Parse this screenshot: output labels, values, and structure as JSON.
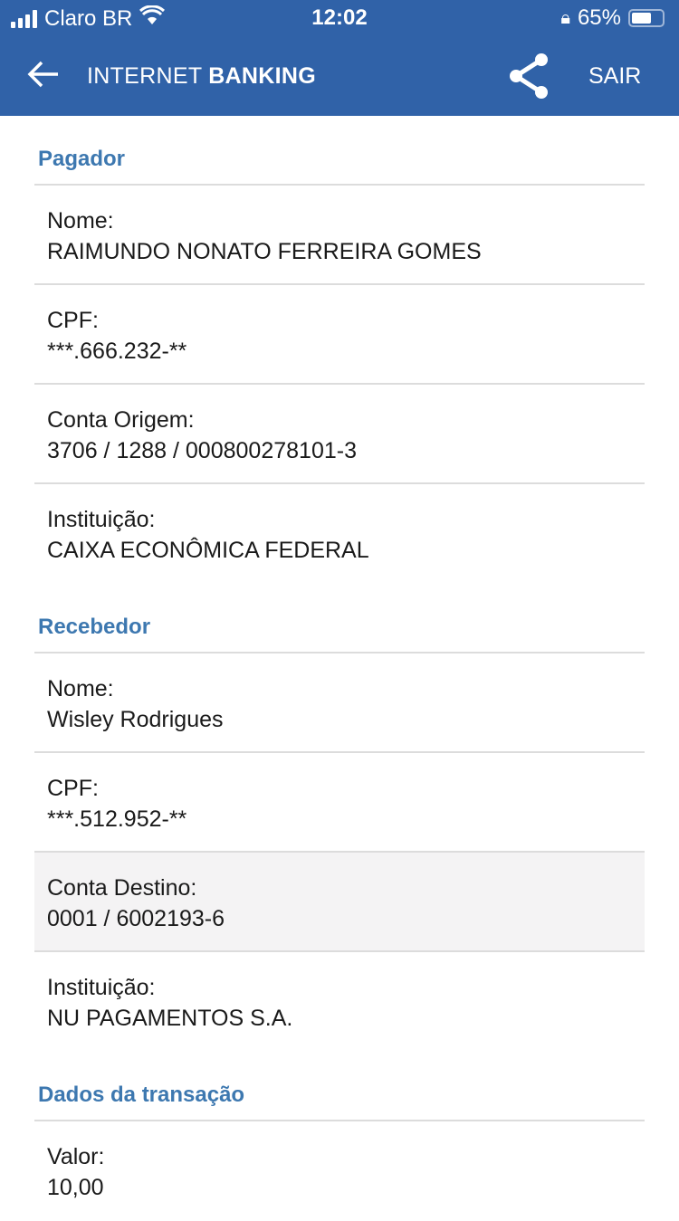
{
  "status": {
    "carrier": "Claro BR",
    "time": "12:02",
    "battery": "65%",
    "battery_level": 0.65
  },
  "header": {
    "title_light": "INTERNET",
    "title_bold": "BANKING",
    "exit": "SAIR",
    "colors": {
      "bar": "#3062a8",
      "section": "#3d78b0"
    }
  },
  "sections": [
    {
      "title": "Pagador",
      "rows": [
        {
          "label": "Nome:",
          "value": "RAIMUNDO NONATO FERREIRA GOMES"
        },
        {
          "label": "CPF:",
          "value": "***.666.232-**"
        },
        {
          "label": "Conta Origem:",
          "value": "3706 / 1288 / 000800278101-3"
        },
        {
          "label": "Instituição:",
          "value": "CAIXA ECONÔMICA FEDERAL"
        }
      ]
    },
    {
      "title": "Recebedor",
      "rows": [
        {
          "label": "Nome:",
          "value": "Wisley Rodrigues"
        },
        {
          "label": "CPF:",
          "value": "***.512.952-**"
        },
        {
          "label": "Conta Destino:",
          "value": "0001 / 6002193-6"
        },
        {
          "label": "Instituição:",
          "value": "NU PAGAMENTOS S.A."
        }
      ]
    },
    {
      "title": "Dados da transação",
      "rows": [
        {
          "label": "Valor:",
          "value": "10,00"
        }
      ]
    }
  ]
}
